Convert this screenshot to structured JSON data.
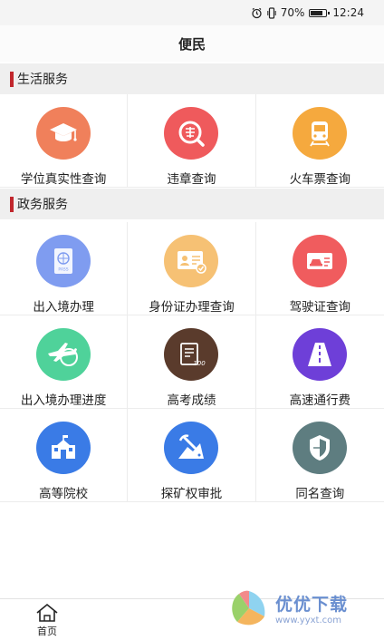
{
  "status": {
    "battery_text": "70%",
    "time": "12:24",
    "battery_level": 0.7
  },
  "header": {
    "title": "便民"
  },
  "sections": {
    "life": {
      "title": "生活服务"
    },
    "gov": {
      "title": "政务服务"
    }
  },
  "life_items": [
    {
      "label": "学位真实性查询",
      "icon": "graduation-cap-icon",
      "color": "#f0805b"
    },
    {
      "label": "违章查询",
      "icon": "traffic-violation-icon",
      "color": "#ef5a5c"
    },
    {
      "label": "火车票查询",
      "icon": "train-icon",
      "color": "#f5a93e"
    }
  ],
  "gov_items": [
    {
      "label": "出入境办理",
      "icon": "passport-icon",
      "color": "#7f9cf0"
    },
    {
      "label": "身份证办理查询",
      "icon": "id-card-icon",
      "color": "#f6c174"
    },
    {
      "label": "驾驶证查询",
      "icon": "driver-license-icon",
      "color": "#f05c5e"
    },
    {
      "label": "出入境办理进度",
      "icon": "airplane-globe-icon",
      "color": "#4fd29a"
    },
    {
      "label": "高考成绩",
      "icon": "exam-score-icon",
      "color": "#5a3b2c"
    },
    {
      "label": "高速通行费",
      "icon": "highway-icon",
      "color": "#6e3fd8"
    },
    {
      "label": "高等院校",
      "icon": "university-icon",
      "color": "#3a7be6"
    },
    {
      "label": "探矿权审批",
      "icon": "mining-icon",
      "color": "#3a7be6"
    },
    {
      "label": "同名查询",
      "icon": "shield-icon",
      "color": "#5e7d80"
    }
  ],
  "nav": {
    "home_label": "首页"
  },
  "watermark": {
    "main": "优优下载",
    "sub": "www.yyxt.com"
  }
}
